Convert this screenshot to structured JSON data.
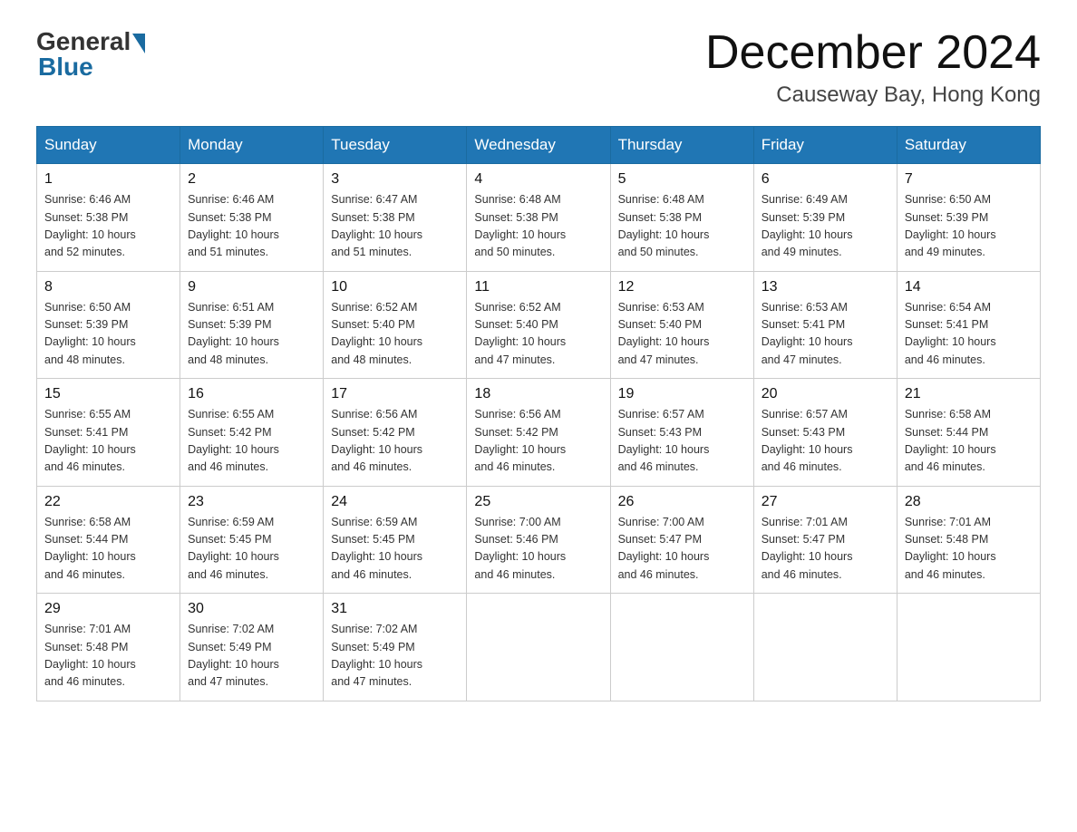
{
  "header": {
    "logo_general": "General",
    "logo_blue": "Blue",
    "month_title": "December 2024",
    "location": "Causeway Bay, Hong Kong"
  },
  "columns": [
    "Sunday",
    "Monday",
    "Tuesday",
    "Wednesday",
    "Thursday",
    "Friday",
    "Saturday"
  ],
  "weeks": [
    [
      {
        "day": "1",
        "sunrise": "6:46 AM",
        "sunset": "5:38 PM",
        "daylight": "10 hours and 52 minutes."
      },
      {
        "day": "2",
        "sunrise": "6:46 AM",
        "sunset": "5:38 PM",
        "daylight": "10 hours and 51 minutes."
      },
      {
        "day": "3",
        "sunrise": "6:47 AM",
        "sunset": "5:38 PM",
        "daylight": "10 hours and 51 minutes."
      },
      {
        "day": "4",
        "sunrise": "6:48 AM",
        "sunset": "5:38 PM",
        "daylight": "10 hours and 50 minutes."
      },
      {
        "day": "5",
        "sunrise": "6:48 AM",
        "sunset": "5:38 PM",
        "daylight": "10 hours and 50 minutes."
      },
      {
        "day": "6",
        "sunrise": "6:49 AM",
        "sunset": "5:39 PM",
        "daylight": "10 hours and 49 minutes."
      },
      {
        "day": "7",
        "sunrise": "6:50 AM",
        "sunset": "5:39 PM",
        "daylight": "10 hours and 49 minutes."
      }
    ],
    [
      {
        "day": "8",
        "sunrise": "6:50 AM",
        "sunset": "5:39 PM",
        "daylight": "10 hours and 48 minutes."
      },
      {
        "day": "9",
        "sunrise": "6:51 AM",
        "sunset": "5:39 PM",
        "daylight": "10 hours and 48 minutes."
      },
      {
        "day": "10",
        "sunrise": "6:52 AM",
        "sunset": "5:40 PM",
        "daylight": "10 hours and 48 minutes."
      },
      {
        "day": "11",
        "sunrise": "6:52 AM",
        "sunset": "5:40 PM",
        "daylight": "10 hours and 47 minutes."
      },
      {
        "day": "12",
        "sunrise": "6:53 AM",
        "sunset": "5:40 PM",
        "daylight": "10 hours and 47 minutes."
      },
      {
        "day": "13",
        "sunrise": "6:53 AM",
        "sunset": "5:41 PM",
        "daylight": "10 hours and 47 minutes."
      },
      {
        "day": "14",
        "sunrise": "6:54 AM",
        "sunset": "5:41 PM",
        "daylight": "10 hours and 46 minutes."
      }
    ],
    [
      {
        "day": "15",
        "sunrise": "6:55 AM",
        "sunset": "5:41 PM",
        "daylight": "10 hours and 46 minutes."
      },
      {
        "day": "16",
        "sunrise": "6:55 AM",
        "sunset": "5:42 PM",
        "daylight": "10 hours and 46 minutes."
      },
      {
        "day": "17",
        "sunrise": "6:56 AM",
        "sunset": "5:42 PM",
        "daylight": "10 hours and 46 minutes."
      },
      {
        "day": "18",
        "sunrise": "6:56 AM",
        "sunset": "5:42 PM",
        "daylight": "10 hours and 46 minutes."
      },
      {
        "day": "19",
        "sunrise": "6:57 AM",
        "sunset": "5:43 PM",
        "daylight": "10 hours and 46 minutes."
      },
      {
        "day": "20",
        "sunrise": "6:57 AM",
        "sunset": "5:43 PM",
        "daylight": "10 hours and 46 minutes."
      },
      {
        "day": "21",
        "sunrise": "6:58 AM",
        "sunset": "5:44 PM",
        "daylight": "10 hours and 46 minutes."
      }
    ],
    [
      {
        "day": "22",
        "sunrise": "6:58 AM",
        "sunset": "5:44 PM",
        "daylight": "10 hours and 46 minutes."
      },
      {
        "day": "23",
        "sunrise": "6:59 AM",
        "sunset": "5:45 PM",
        "daylight": "10 hours and 46 minutes."
      },
      {
        "day": "24",
        "sunrise": "6:59 AM",
        "sunset": "5:45 PM",
        "daylight": "10 hours and 46 minutes."
      },
      {
        "day": "25",
        "sunrise": "7:00 AM",
        "sunset": "5:46 PM",
        "daylight": "10 hours and 46 minutes."
      },
      {
        "day": "26",
        "sunrise": "7:00 AM",
        "sunset": "5:47 PM",
        "daylight": "10 hours and 46 minutes."
      },
      {
        "day": "27",
        "sunrise": "7:01 AM",
        "sunset": "5:47 PM",
        "daylight": "10 hours and 46 minutes."
      },
      {
        "day": "28",
        "sunrise": "7:01 AM",
        "sunset": "5:48 PM",
        "daylight": "10 hours and 46 minutes."
      }
    ],
    [
      {
        "day": "29",
        "sunrise": "7:01 AM",
        "sunset": "5:48 PM",
        "daylight": "10 hours and 46 minutes."
      },
      {
        "day": "30",
        "sunrise": "7:02 AM",
        "sunset": "5:49 PM",
        "daylight": "10 hours and 47 minutes."
      },
      {
        "day": "31",
        "sunrise": "7:02 AM",
        "sunset": "5:49 PM",
        "daylight": "10 hours and 47 minutes."
      },
      null,
      null,
      null,
      null
    ]
  ]
}
